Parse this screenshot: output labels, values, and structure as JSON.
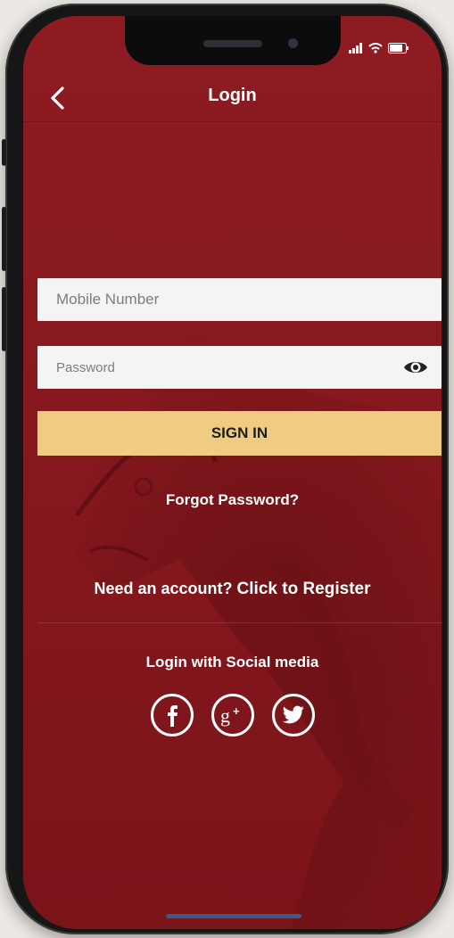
{
  "header": {
    "title": "Login"
  },
  "form": {
    "mobile_placeholder": "Mobile Number",
    "password_placeholder": "Password",
    "signin_label": "SIGN IN",
    "forgot_label": "Forgot Password?"
  },
  "register": {
    "prompt": "Need an account?",
    "link_label": "Click to Register"
  },
  "social": {
    "heading": "Login with Social media",
    "icons": [
      "facebook-icon",
      "google-plus-icon",
      "twitter-icon"
    ]
  },
  "colors": {
    "background": "#8d1c22",
    "accent_button": "#f0cb82",
    "field_background": "#f4f4f4"
  }
}
